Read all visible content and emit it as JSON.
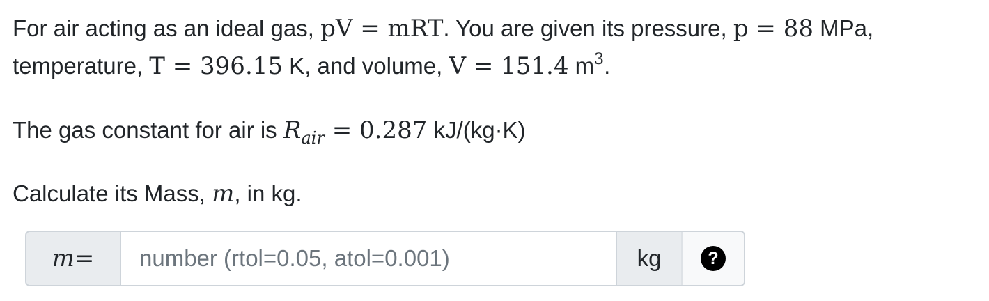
{
  "question": {
    "line1": {
      "intro": "For air acting as an ideal gas, ",
      "equation": "pV = mRT",
      "after_equation": ". You are given its pressure, ",
      "pressure_lhs": "p = 88",
      "pressure_unit": " MPa,"
    },
    "line2": {
      "prefix": "temperature, ",
      "temperature_lhs": "T = 396.15",
      "temperature_unit": " K, and volume, ",
      "volume_lhs": "V = 151.4",
      "volume_unit": " m",
      "volume_exponent": "3",
      "end": "."
    },
    "gas_constant": {
      "text": "The gas constant for air is ",
      "symbol": "R",
      "subscript": "air",
      "equals_value": " = 0.287",
      "unit": " kJ/(kg·K)"
    },
    "prompt": {
      "text": "Calculate its Mass, ",
      "variable": "m",
      "suffix": ", in kg."
    }
  },
  "answer_input": {
    "label_variable": "m",
    "label_equals": " =",
    "placeholder": "number (rtol=0.05, atol=0.001)",
    "value": "",
    "unit": "kg",
    "help_symbol": "?"
  },
  "colors": {
    "text": "#212529",
    "addon_background": "#e9ecef",
    "border": "#ced4da",
    "placeholder": "#6c757d",
    "help_icon": "#000000"
  }
}
